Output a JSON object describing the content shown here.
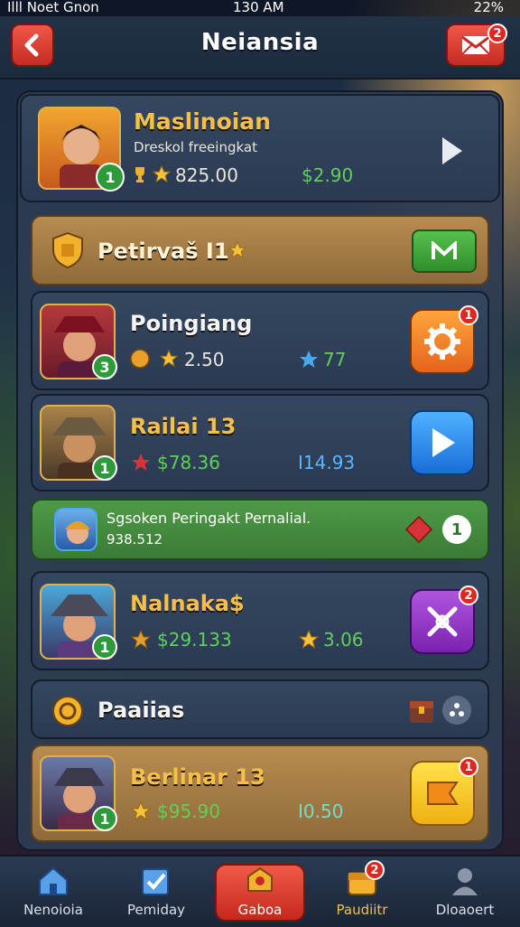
{
  "status": {
    "carrier": "Illl Noet Gnon",
    "time": "130 AM",
    "battery": "22%"
  },
  "header": {
    "title": "Neiansia",
    "mail_badge": "2"
  },
  "top_player": {
    "name": "Maslinoian",
    "subtitle": "Dreskol freeingkat",
    "level": "1",
    "stars": "825.00",
    "money": "$2.90"
  },
  "rank_banner": {
    "label": "Petirvaš I1"
  },
  "players": [
    {
      "name": "Poingiang",
      "level": "3",
      "stat": "2.50",
      "side": "77",
      "action_badge": "1"
    },
    {
      "name": "Railai 13",
      "level": "1",
      "money": "$78.36",
      "side": "I14.93"
    },
    {
      "name": "Nalnaka$",
      "level": "1",
      "money": "$29.133",
      "side": "3.06",
      "action_badge": "2"
    },
    {
      "name": "Berlinar 13",
      "level": "1",
      "money": "$95.90",
      "side": "I0.50",
      "action_badge": "1"
    }
  ],
  "notice": {
    "text": "Sgsoken Peringakt Pernalial.",
    "sub": "938.512",
    "count": "1"
  },
  "section": {
    "label": "Paaiias"
  },
  "nav": [
    {
      "label": "Nenoioia",
      "icon": "home-icon"
    },
    {
      "label": "Pemiday",
      "icon": "quest-icon"
    },
    {
      "label": "Gaboa",
      "icon": "shop-icon"
    },
    {
      "label": "Paudiitr",
      "icon": "chest-icon",
      "badge": "2"
    },
    {
      "label": "Dloaoert",
      "icon": "profile-icon"
    }
  ]
}
